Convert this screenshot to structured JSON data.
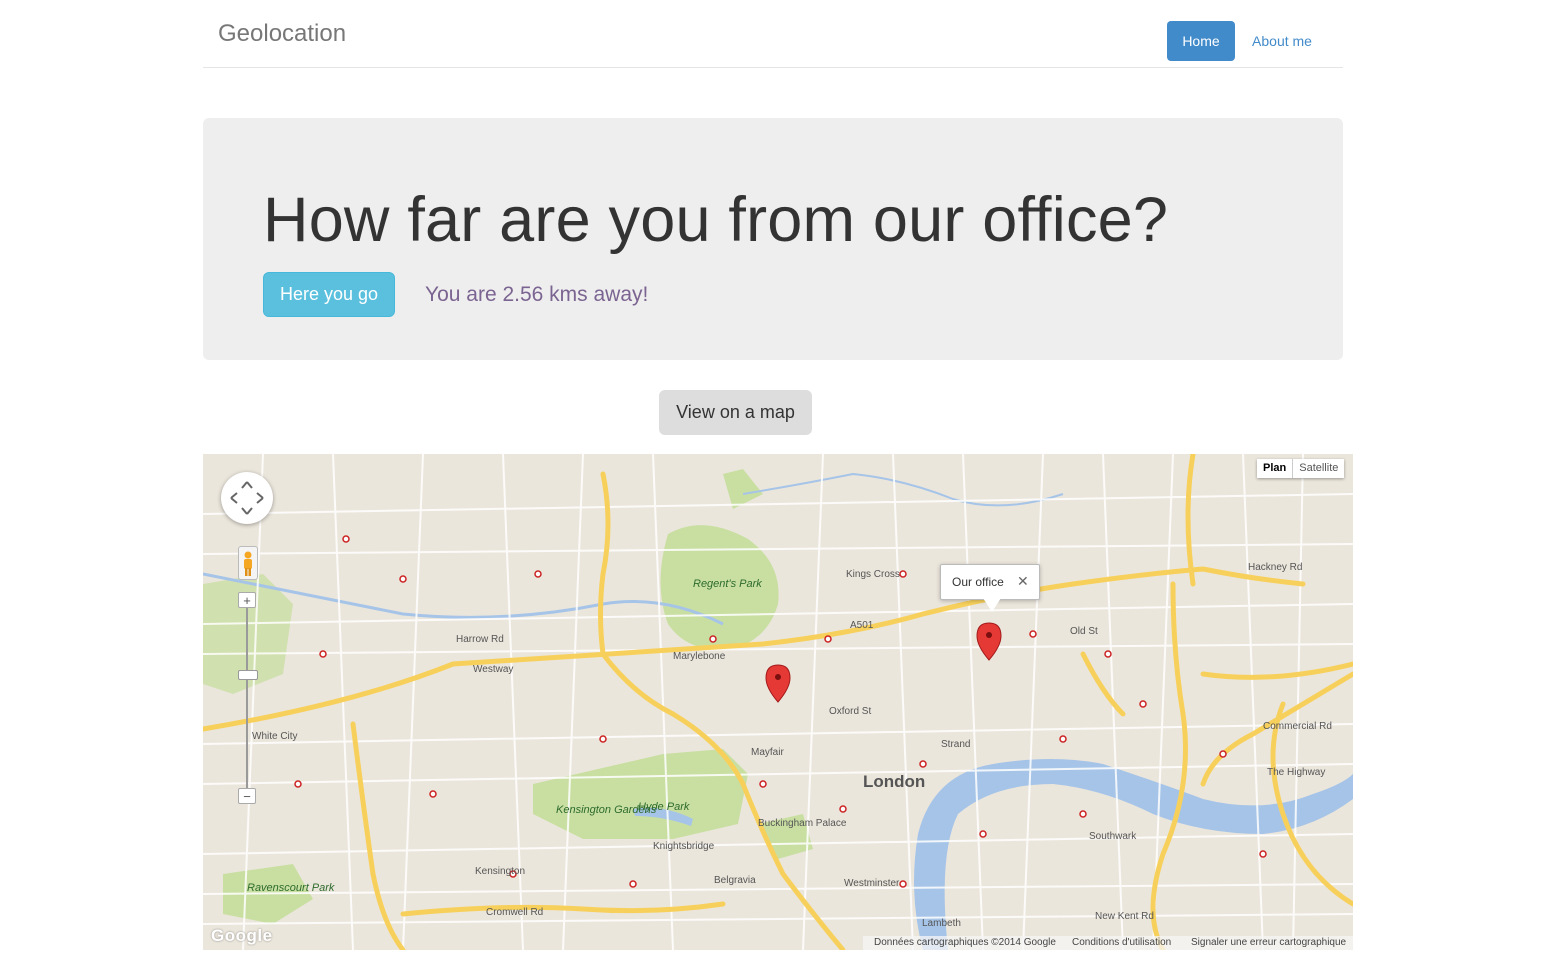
{
  "navbar": {
    "brand": "Geolocation",
    "home": "Home",
    "about": "About me"
  },
  "jumbotron": {
    "title": "How far are you from our office?",
    "button": "Here you go",
    "distance_text": "You are 2.56 kms away!"
  },
  "view_map_button": "View on a map",
  "map": {
    "type_control": {
      "plan": "Plan",
      "satellite": "Satellite"
    },
    "zoom_in": "+",
    "zoom_out": "−",
    "infowindow": {
      "label": "Our office",
      "close": "✕"
    },
    "logo": "Google",
    "footer": {
      "data": "Données cartographiques ©2014 Google",
      "terms": "Conditions d'utilisation",
      "report": "Signaler une erreur cartographique"
    },
    "labels": {
      "london": "London",
      "regents_park": "Regent's Park",
      "hyde_park": "Hyde Park",
      "kensington_gardens": "Kensington Gardens",
      "ravenscourt_park": "Ravenscourt Park",
      "marylebone": "Marylebone",
      "mayfair": "Mayfair",
      "kings_cross": "Kings Cross",
      "southwark": "Southwark",
      "buckingham_palace": "Buckingham Palace",
      "white_city": "White City",
      "westminster": "Westminster",
      "knightsbridge": "Knightsbridge",
      "belgravia": "Belgravia",
      "kensington": "Kensington",
      "lambeth": "Lambeth",
      "oxford_st": "Oxford St",
      "westway": "Westway",
      "strand": "Strand",
      "old_st": "Old St",
      "hackney_rd": "Hackney Rd",
      "commercial_rd": "Commercial Rd",
      "the_highway": "The Highway",
      "new_kent_rd": "New Kent Rd",
      "cromwell_rd": "Cromwell Rd",
      "harrow_rd": "Harrow Rd",
      "euston_rd": "A501"
    }
  },
  "colors": {
    "primary": "#428bca",
    "info": "#5bc0de",
    "jumbotron_bg": "#eeeeee",
    "distance": "#7b6491",
    "river": "#a6c4e8",
    "park": "#c9dfa2",
    "major_road": "#f7d05c"
  }
}
